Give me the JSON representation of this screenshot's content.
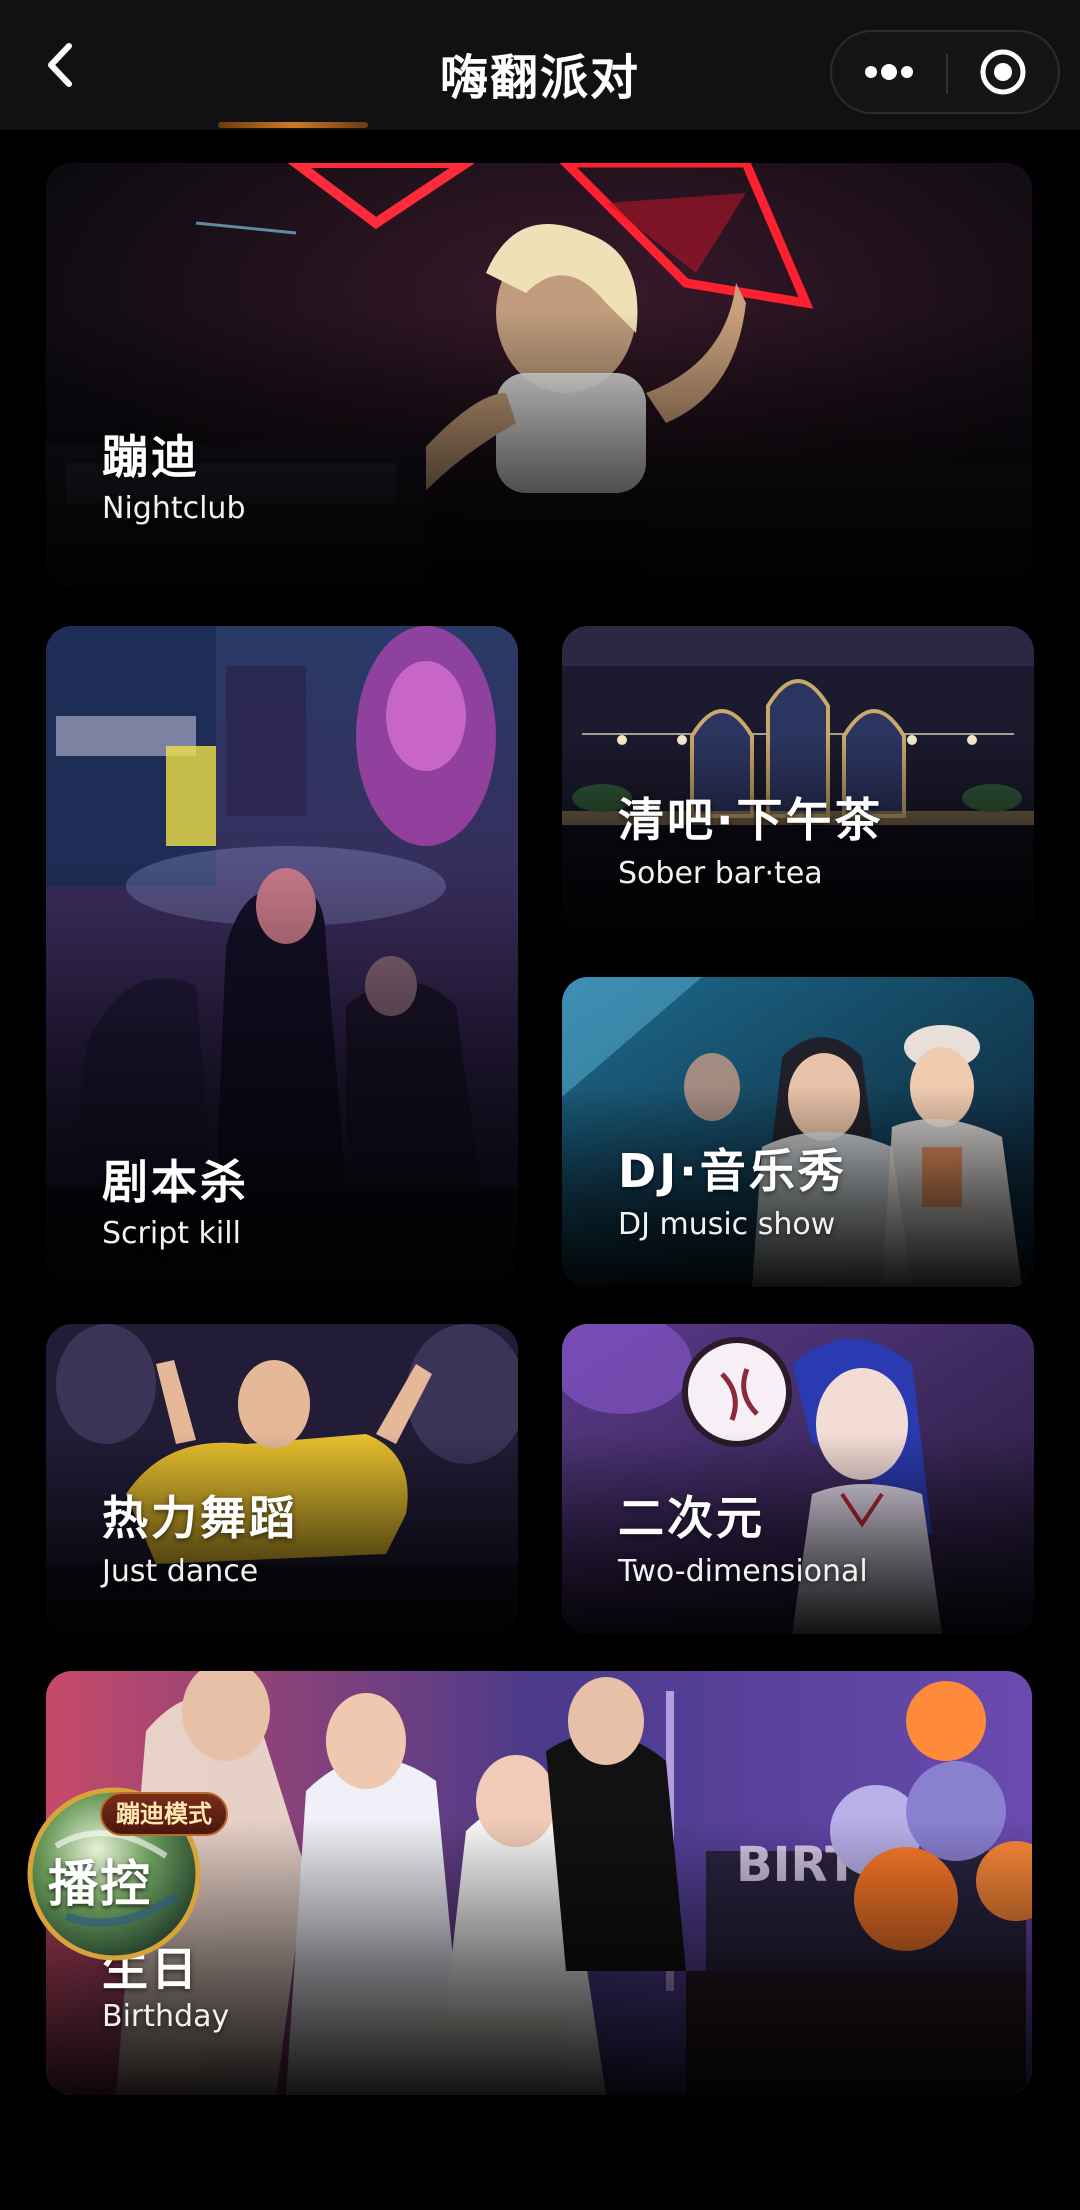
{
  "navbar": {
    "title": "嗨翻派对"
  },
  "colors": {
    "background": "#000000",
    "navbar": "#111111",
    "accent": "#d07a26"
  },
  "cards": {
    "nightclub": {
      "title": "蹦迪",
      "subtitle": "Nightclub"
    },
    "sober": {
      "title": "清吧·下午茶",
      "subtitle": "Sober bar·tea"
    },
    "script": {
      "title": "剧本杀",
      "subtitle": "Script kill"
    },
    "dj": {
      "title": "DJ·音乐秀",
      "subtitle": "DJ music show"
    },
    "dance": {
      "title": "热力舞蹈",
      "subtitle": "Just dance"
    },
    "anime": {
      "title": "二次元",
      "subtitle": "Two-dimensional"
    },
    "birthday": {
      "title": "生日",
      "subtitle": "Birthday"
    }
  },
  "mini_player": {
    "badge": "蹦迪模式",
    "label": "播控"
  },
  "icons": {
    "back": "chevron-left-icon",
    "more": "more-dots-icon",
    "close": "target-circle-icon"
  }
}
